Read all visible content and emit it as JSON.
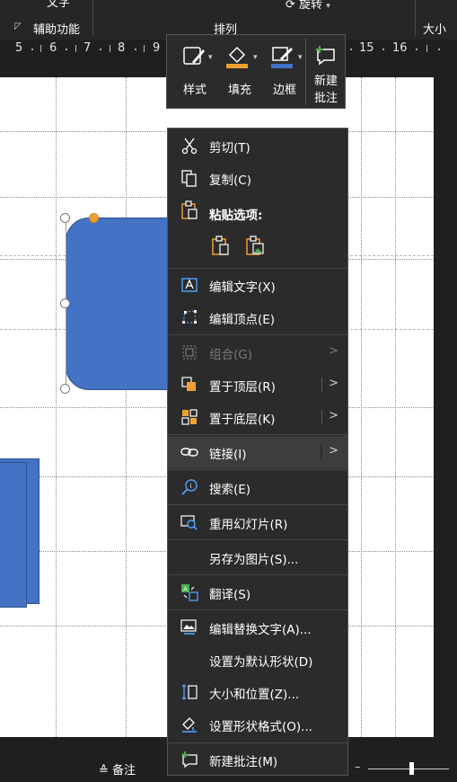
{
  "ribbon": {
    "top_fragment": "文字",
    "accessibility_label": "辅助功能",
    "arrange_label": "排列",
    "rotate_label": "旋转",
    "size_label": "大小"
  },
  "ruler": {
    "numbers": [
      "5",
      "6",
      "7",
      "8",
      "9",
      "15",
      "16"
    ]
  },
  "mini_toolbar": {
    "style_label": "样式",
    "fill_label": "填充",
    "border_label": "边框",
    "new_comment_line1": "新建",
    "new_comment_line2": "批注"
  },
  "context_menu": {
    "cut": "剪切(T)",
    "copy": "复制(C)",
    "paste_options": "粘贴选项:",
    "edit_text": "编辑文字(X)",
    "edit_points": "编辑顶点(E)",
    "group": "组合(G)",
    "bring_to_front": "置于顶层(R)",
    "send_to_back": "置于底层(K)",
    "link": "链接(I)",
    "search": "搜索(E)",
    "reuse_slides": "重用幻灯片(R)",
    "save_as_picture": "另存为图片(S)...",
    "translate": "翻译(S)",
    "edit_alt_text": "编辑替换文字(A)...",
    "set_default_shape": "设置为默认形状(D)",
    "size_position": "大小和位置(Z)...",
    "format_shape": "设置形状格式(O)...",
    "new_comment": "新建批注(M)"
  },
  "status_bar": {
    "notes_label": "备注"
  },
  "colors": {
    "shape_fill": "#4472c4",
    "fill_accent": "#f0a030",
    "border_accent": "#4472c4",
    "comment_accent": "#4caf50"
  }
}
